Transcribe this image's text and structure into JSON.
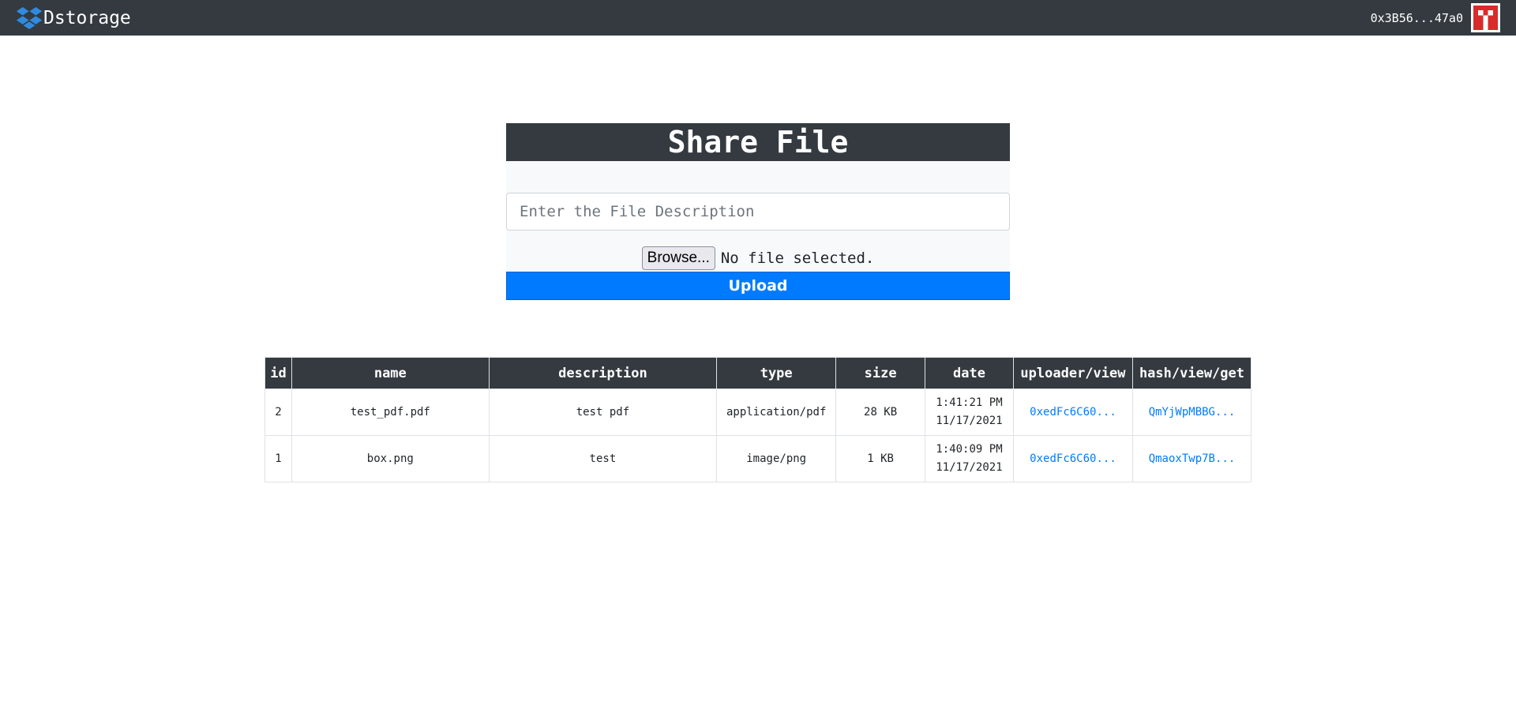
{
  "navbar": {
    "brand": "Dstorage",
    "brand_icon": "dropbox-logo-icon",
    "account_address": "0x3B56...47a0",
    "avatar_icon": "identicon-avatar"
  },
  "upload": {
    "title": "Share File",
    "description_placeholder": "Enter the File Description",
    "browse_label": "Browse...",
    "file_status": "No file selected.",
    "upload_label": "Upload"
  },
  "table": {
    "headers": [
      "id",
      "name",
      "description",
      "type",
      "size",
      "date",
      "uploader/view",
      "hash/view/get"
    ],
    "rows": [
      {
        "id": "2",
        "name": "test_pdf.pdf",
        "description": "test pdf",
        "type": "application/pdf",
        "size": "28 KB",
        "time": "1:41:21 PM",
        "date": "11/17/2021",
        "uploader": "0xedFc6C60...",
        "hash": "QmYjWpMBBG..."
      },
      {
        "id": "1",
        "name": "box.png",
        "description": "test",
        "type": "image/png",
        "size": "1 KB",
        "time": "1:40:09 PM",
        "date": "11/17/2021",
        "uploader": "0xedFc6C60...",
        "hash": "QmaoxTwp7B..."
      }
    ]
  },
  "colors": {
    "navbar_bg": "#343a40",
    "primary": "#007bff",
    "card_bg": "#f8f9fa"
  }
}
